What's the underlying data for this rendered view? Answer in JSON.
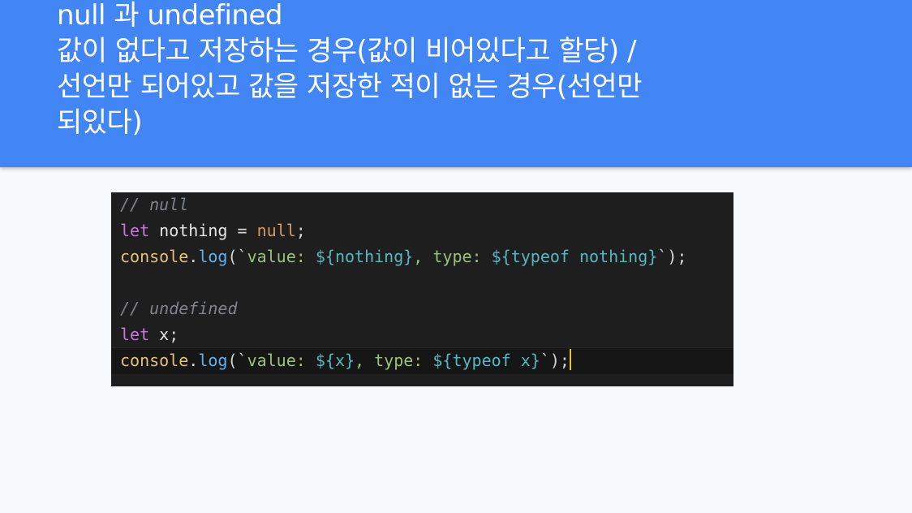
{
  "slide": {
    "title_lines": [
      "null 과 undefined",
      "값이 없다고 저장하는 경우(값이 비어있다고 할당) /",
      "선언만 되어있고 값을 저장한 적이 없는 경우(선언만",
      "되있다)"
    ]
  },
  "code": {
    "line1": {
      "comment_slashes": "//",
      "comment_text": "null"
    },
    "line2": {
      "kw": "let",
      "name": "nothing",
      "op": "=",
      "value": "null",
      "end": ";"
    },
    "line3": {
      "obj": "console",
      "dot": ".",
      "method": "log",
      "open": "(`",
      "s1": "value: ",
      "t1": "${nothing}",
      "s2": ", type: ",
      "t2": "${typeof nothing}",
      "close": "`);"
    },
    "line5": {
      "comment_slashes": "//",
      "comment_text": "undefined"
    },
    "line6": {
      "kw": "let",
      "name": "x",
      "end": ";"
    },
    "line7": {
      "obj": "console",
      "dot": ".",
      "method": "log",
      "open": "(`",
      "s1": "value: ",
      "t1": "${x}",
      "s2": ", type: ",
      "t2": "${typeof x}",
      "close": "`);"
    }
  },
  "colors": {
    "header_bg": "#4285f4",
    "code_bg": "#1e1e1e",
    "cursor": "#e8c22e"
  }
}
